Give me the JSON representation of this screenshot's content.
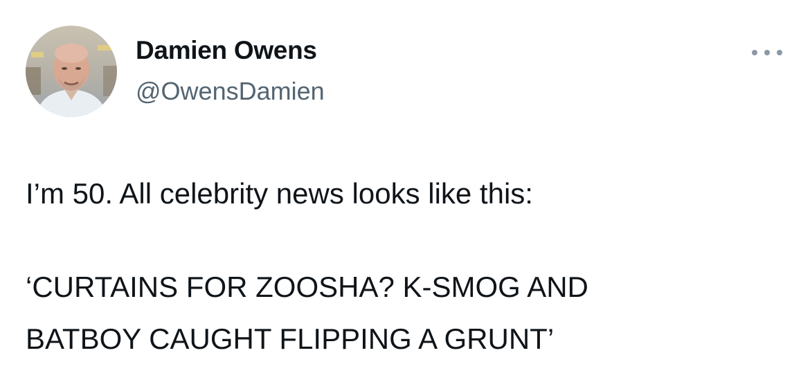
{
  "tweet": {
    "author": {
      "display_name": "Damien Owens",
      "handle": "@OwensDamien",
      "avatar_icon": "profile-photo"
    },
    "more_icon": "more-options-icon",
    "text_lines": [
      "I’m 50. All celebrity news looks like this:",
      "‘CURTAINS FOR ZOOSHA? K-SMOG AND",
      "BATBOY CAUGHT FLIPPING A GRUNT’"
    ]
  },
  "colors": {
    "text_primary": "#0f1419",
    "text_secondary": "#536471",
    "icon_gray": "#8b98a5",
    "background": "#ffffff"
  }
}
